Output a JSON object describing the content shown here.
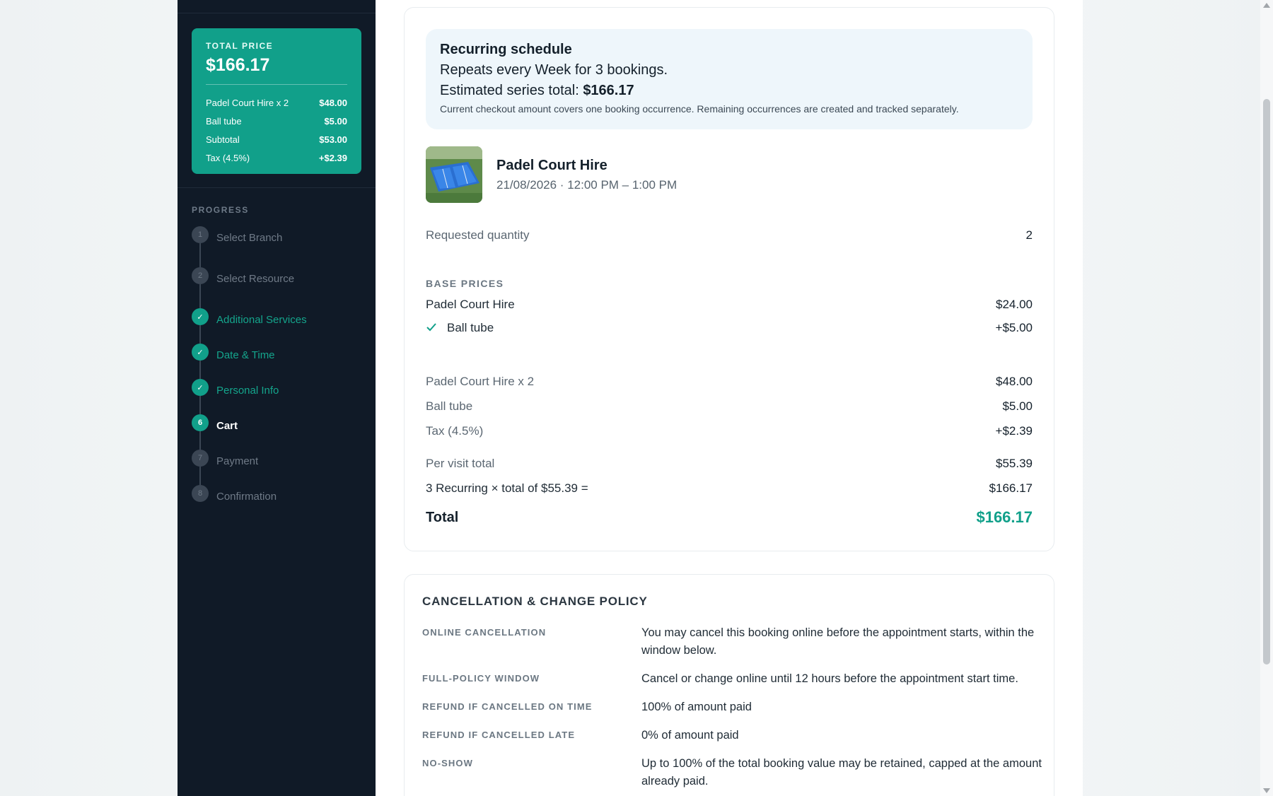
{
  "sidebar": {
    "total_price_label": "TOTAL PRICE",
    "total_price": "$166.17",
    "price_lines": [
      {
        "label": "Padel Court Hire x 2",
        "value": "$48.00"
      },
      {
        "label": "Ball tube",
        "value": "$5.00"
      },
      {
        "label": "Subtotal",
        "value": "$53.00"
      },
      {
        "label": "Tax (4.5%)",
        "value": "+$2.39"
      }
    ],
    "progress_label": "PROGRESS",
    "steps": [
      {
        "num": "1",
        "label": "Select Branch",
        "state": "pending"
      },
      {
        "num": "2",
        "label": "Select Resource",
        "state": "pending"
      },
      {
        "num": "✓",
        "label": "Additional Services",
        "state": "done"
      },
      {
        "num": "✓",
        "label": "Date & Time",
        "state": "done"
      },
      {
        "num": "✓",
        "label": "Personal Info",
        "state": "done"
      },
      {
        "num": "6",
        "label": "Cart",
        "state": "current"
      },
      {
        "num": "7",
        "label": "Payment",
        "state": "pending"
      },
      {
        "num": "8",
        "label": "Confirmation",
        "state": "pending"
      }
    ]
  },
  "recurring": {
    "title": "Recurring schedule",
    "repeats": "Repeats every Week for 3 bookings.",
    "estimate_label": "Estimated series total:",
    "estimate_value": "$166.17",
    "note": "Current checkout amount covers one booking occurrence. Remaining occurrences are created and tracked separately."
  },
  "item": {
    "title": "Padel Court Hire",
    "when": "21/08/2026 · 12:00 PM – 1:00 PM"
  },
  "quantity": {
    "label": "Requested quantity",
    "value": "2"
  },
  "base_prices": {
    "heading": "BASE PRICES",
    "lines": [
      {
        "label": "Padel Court Hire",
        "value": "$24.00"
      },
      {
        "label": "Ball tube",
        "value": "+$5.00"
      }
    ]
  },
  "breakdown": [
    {
      "label": "Padel Court Hire x 2",
      "value": "$48.00"
    },
    {
      "label": "Ball tube",
      "value": "$5.00"
    },
    {
      "label": "Tax (4.5%)",
      "value": "+$2.39"
    }
  ],
  "per_visit": {
    "label": "Per visit total",
    "value": "$55.39"
  },
  "recurring_calc": {
    "label": "3 Recurring × total of $55.39 =",
    "value": "$166.17"
  },
  "total": {
    "label": "Total",
    "value": "$166.17"
  },
  "policy": {
    "title": "CANCELLATION & CHANGE POLICY",
    "rows": [
      {
        "key": "ONLINE CANCELLATION",
        "value": "You may cancel this booking online before the appointment starts, within the window below."
      },
      {
        "key": "FULL-POLICY WINDOW",
        "value": "Cancel or change online until 12 hours before the appointment start time."
      },
      {
        "key": "REFUND IF CANCELLED ON TIME",
        "value": "100% of amount paid"
      },
      {
        "key": "REFUND IF CANCELLED LATE",
        "value": "0% of amount paid"
      },
      {
        "key": "NO-SHOW",
        "value": "Up to 100% of the total booking value may be retained, capped at the amount already paid."
      }
    ]
  },
  "colors": {
    "accent": "#11a08a",
    "sidebar": "#101a27"
  }
}
